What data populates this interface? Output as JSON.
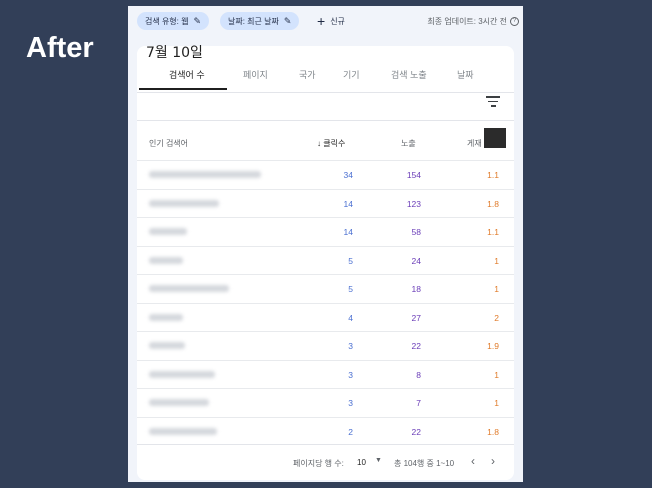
{
  "slide_label": "After",
  "filters": {
    "chip_search_type": "검색 유형: 웹",
    "chip_date": "날짜: 최근 날짜",
    "new_label": "신규",
    "updated": "최종 업데이트: 3시간 전"
  },
  "date_title": "7월 10일",
  "tabs": [
    {
      "label": "검색어 수"
    },
    {
      "label": "페이지"
    },
    {
      "label": "국가"
    },
    {
      "label": "기기"
    },
    {
      "label": "검색 노출"
    },
    {
      "label": "날짜"
    }
  ],
  "table": {
    "headers": {
      "query": "인기 검색어",
      "clicks": "클릭수",
      "impressions": "노출",
      "position": "게재"
    },
    "rows": [
      {
        "clicks": "34",
        "impressions": "154",
        "position": "1.1"
      },
      {
        "clicks": "14",
        "impressions": "123",
        "position": "1.8"
      },
      {
        "clicks": "14",
        "impressions": "58",
        "position": "1.1"
      },
      {
        "clicks": "5",
        "impressions": "24",
        "position": "1"
      },
      {
        "clicks": "5",
        "impressions": "18",
        "position": "1"
      },
      {
        "clicks": "4",
        "impressions": "27",
        "position": "2"
      },
      {
        "clicks": "3",
        "impressions": "22",
        "position": "1.9"
      },
      {
        "clicks": "3",
        "impressions": "8",
        "position": "1"
      },
      {
        "clicks": "3",
        "impressions": "7",
        "position": "1"
      },
      {
        "clicks": "2",
        "impressions": "22",
        "position": "1.8"
      }
    ]
  },
  "pagination": {
    "rows_per_page_label": "페이지당 행 수:",
    "rows_per_page_value": "10",
    "range": "총 104행 중 1~10"
  },
  "colors": {
    "background": "#323f58",
    "clicks": "#4a6fd1",
    "impressions": "#6a3db8",
    "position": "#e07b2a",
    "chip": "#d3e3fd"
  }
}
